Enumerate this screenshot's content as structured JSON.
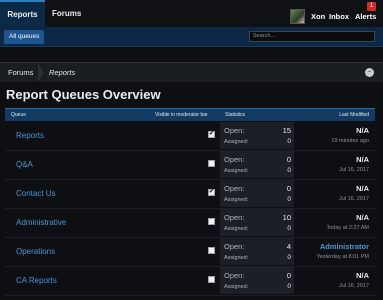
{
  "nav": {
    "tabs": [
      {
        "label": "Reports"
      },
      {
        "label": "Forums"
      }
    ],
    "user": {
      "name": "Xon"
    },
    "inbox": "Inbox",
    "alerts": "Alerts",
    "alerts_count": "1",
    "sub_tab": "All queues",
    "search_placeholder": "Search..."
  },
  "breadcrumb": {
    "items": [
      "Forums",
      "Reports"
    ]
  },
  "page": {
    "title": "Report Queues Overview"
  },
  "table": {
    "headers": {
      "queue": "Queue",
      "visible": "Visible in moderator bar",
      "stats": "Statistics",
      "last": "Last Modified"
    },
    "open_label": "Open:",
    "assigned_label": "Assigned:",
    "rows": [
      {
        "name": "Reports",
        "visible": true,
        "open": "15",
        "assigned": "0",
        "last_main": "N/A",
        "last_sub": "19 minutes ago",
        "last_is_link": false
      },
      {
        "name": "Q&A",
        "visible": false,
        "open": "0",
        "assigned": "0",
        "last_main": "N/A",
        "last_sub": "Jul 16, 2017",
        "last_is_link": false
      },
      {
        "name": "Contact Us",
        "visible": true,
        "open": "0",
        "assigned": "0",
        "last_main": "N/A",
        "last_sub": "Jul 16, 2017",
        "last_is_link": false
      },
      {
        "name": "Administrative",
        "visible": false,
        "open": "10",
        "assigned": "0",
        "last_main": "N/A",
        "last_sub": "Today at 2:27 AM",
        "last_is_link": false
      },
      {
        "name": "Operations",
        "visible": false,
        "open": "4",
        "assigned": "0",
        "last_main": "Administrator",
        "last_sub": "Yesterday at 8:01 PM",
        "last_is_link": true
      },
      {
        "name": "CA Reports",
        "visible": false,
        "open": "0",
        "assigned": "0",
        "last_main": "N/A",
        "last_sub": "Jul 16, 2017",
        "last_is_link": false
      }
    ]
  }
}
